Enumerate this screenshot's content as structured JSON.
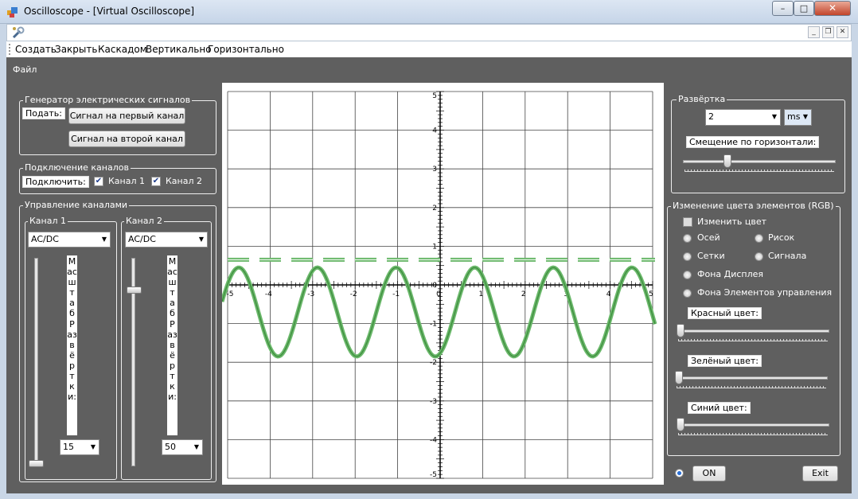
{
  "window": {
    "title": "Oscilloscope - [Virtual Oscilloscope]"
  },
  "title_buttons": {
    "minimize": "–",
    "maximize": "□",
    "close": "✕"
  },
  "mdi_buttons": {
    "minimize": "_",
    "restore": "❐",
    "close": "✕"
  },
  "menubar": {
    "items": [
      "Создать",
      "Закрыть",
      "Каскадом",
      "Вертикально",
      "Горизонтально"
    ]
  },
  "file_menu": "Файл",
  "generator": {
    "title": "Генератор электрических сигналов",
    "feed_label": "Подать:",
    "btn1": "Сигнал на первый канал",
    "btn2": "Сигнал на второй канал"
  },
  "connection": {
    "title": "Подключение каналов",
    "label": "Подключить:",
    "ch1": "Канал 1",
    "ch2": "Канал 2",
    "ch1_checked": true,
    "ch2_checked": true
  },
  "channels": {
    "title": "Управление каналами",
    "ch1": {
      "title": "Канал 1",
      "mode": "AC/DC",
      "scale_label": "Масштаб Развёртки:",
      "scale_value": "15",
      "slider_level": 0.0
    },
    "ch2": {
      "title": "Канал 2",
      "mode": "AC/DC",
      "scale_label": "Масштаб Развёртки:",
      "scale_value": "50",
      "slider_level": 0.86
    }
  },
  "sweep": {
    "title": "Развёртка",
    "value": "2",
    "unit": "ms",
    "offset_label": "Смещение по горизонтали:",
    "offset_level": 0.28
  },
  "colors": {
    "title": "Изменение цвета элементов (RGB)",
    "change_label": "Изменить цвет",
    "radios": {
      "axes": "Осей",
      "drawing": "Рисок",
      "grid": "Сетки",
      "signal": "Сигнала",
      "display_bg": "Фона Дисплея",
      "controls_bg": "Фона Элементов управления"
    },
    "red_label": "Красный цвет:",
    "green_label": "Зелёный цвет:",
    "blue_label": "Синий цвет:",
    "red_level": 0.0,
    "green_level": 0.0,
    "blue_level": 0.0
  },
  "bottom": {
    "on": "ON",
    "exit": "Exit"
  },
  "chart_data": {
    "type": "line",
    "xlim": [
      -5,
      5
    ],
    "ylim": [
      -5,
      5
    ],
    "xticks": [
      "-5",
      "-4",
      "-3",
      "-2",
      "-1",
      "0",
      "1",
      "2",
      "3",
      "4",
      "5"
    ],
    "yticks": [
      "-5",
      "-4",
      "-3",
      "-2",
      "-1",
      "0",
      "1",
      "2",
      "3",
      "4",
      "5"
    ],
    "grid": true,
    "series": [
      {
        "style": "dashed",
        "color": "#6ab86a",
        "y": 0.65
      },
      {
        "style": "sine",
        "color": "#6ab86a",
        "offset": -0.7,
        "amplitude": 1.15,
        "period": 1.85,
        "phase": 0.35
      }
    ]
  }
}
